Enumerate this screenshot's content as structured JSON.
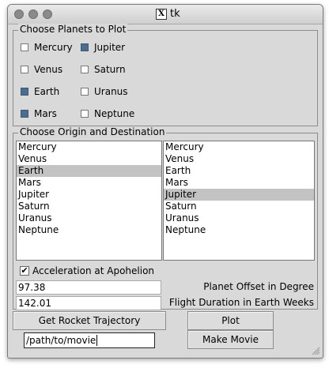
{
  "window": {
    "title": "tk",
    "title_icon": "X"
  },
  "planets_group": {
    "title": "Choose Planets to Plot",
    "col1": [
      {
        "label": "Mercury",
        "checked": false
      },
      {
        "label": "Venus",
        "checked": false
      },
      {
        "label": "Earth",
        "checked": true
      },
      {
        "label": "Mars",
        "checked": true
      }
    ],
    "col2": [
      {
        "label": "Jupiter",
        "checked": true
      },
      {
        "label": "Saturn",
        "checked": false
      },
      {
        "label": "Uranus",
        "checked": false
      },
      {
        "label": "Neptune",
        "checked": false
      }
    ]
  },
  "route_group": {
    "title": "Choose Origin and Destination",
    "origin_list": [
      "Mercury",
      "Venus",
      "Earth",
      "Mars",
      "Jupiter",
      "Saturn",
      "Uranus",
      "Neptune"
    ],
    "origin_selected": "Earth",
    "destination_list": [
      "Mercury",
      "Venus",
      "Earth",
      "Mars",
      "Jupiter",
      "Saturn",
      "Uranus",
      "Neptune"
    ],
    "destination_selected": "Jupiter"
  },
  "options": {
    "accel_label": "Acceleration at Apohelion",
    "accel_checked": true,
    "offset_value": "97.38",
    "offset_label": "Planet Offset in Degree",
    "duration_value": "142.01",
    "duration_label": "Flight Duration in Earth Weeks"
  },
  "buttons": {
    "trajectory": "Get Rocket Trajectory",
    "plot": "Plot",
    "make_movie": "Make Movie"
  },
  "movie_path": "/path/to/movie",
  "colors": {
    "checked_fill": "#4b6c8c",
    "selection": "#c3c3c3",
    "window_bg": "#d9d9d9"
  }
}
